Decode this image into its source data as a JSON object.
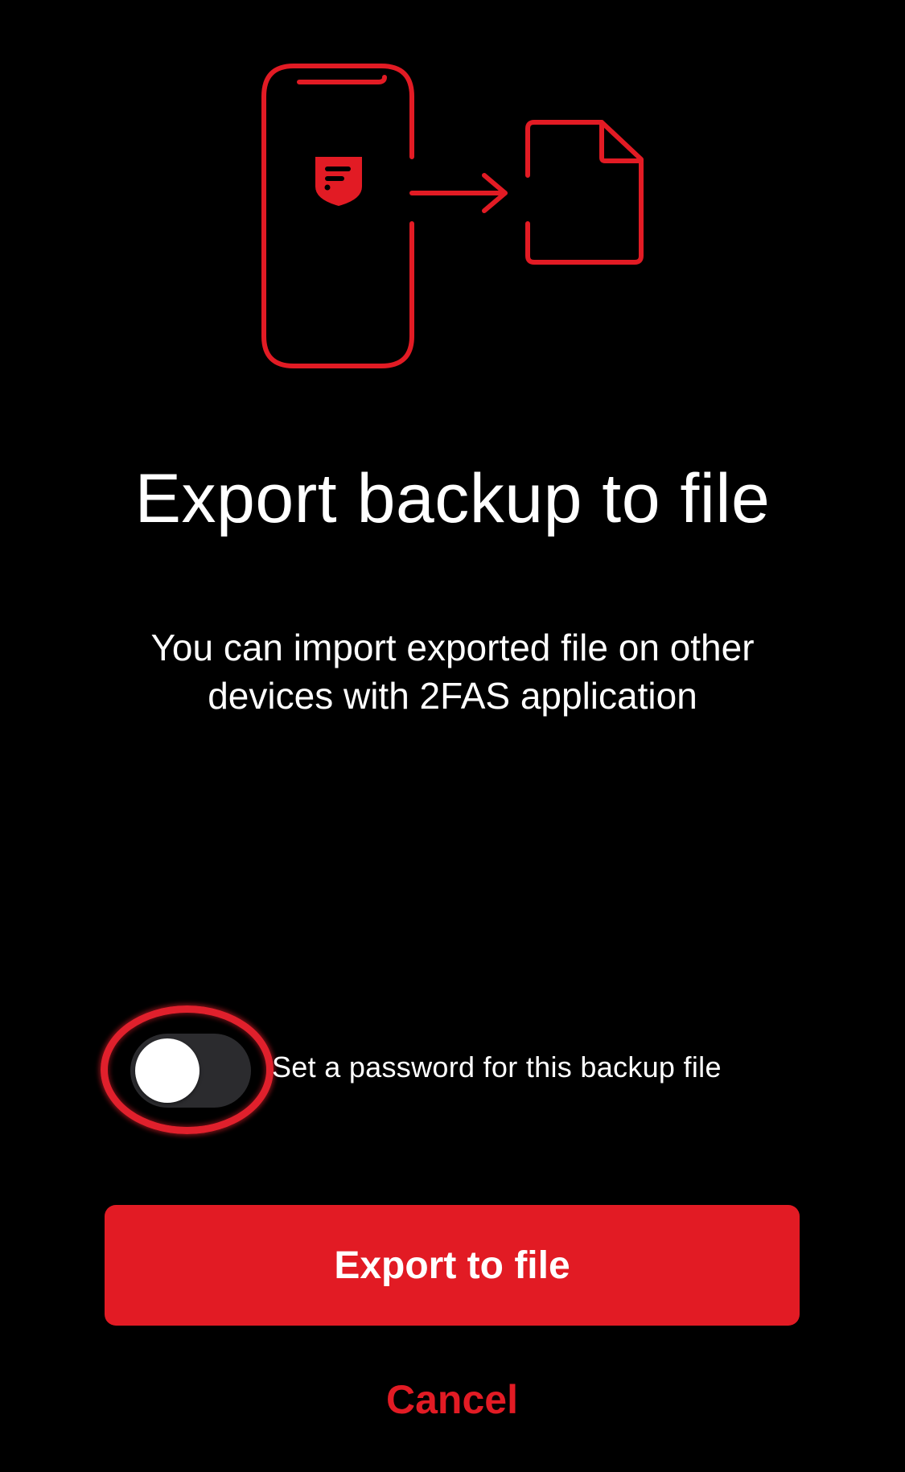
{
  "colors": {
    "background": "#000000",
    "accent": "#e21b24",
    "text": "#ffffff",
    "toggle_track_off": "#2b2b2e"
  },
  "illustration": {
    "phone_icon": "phone-outline-icon",
    "logo_icon": "2fas-shield-logo-icon",
    "arrow_icon": "arrow-right-icon",
    "file_icon": "document-file-icon"
  },
  "main": {
    "title": "Export backup to file",
    "subtitle": "You can import exported file on other devices with 2FAS application"
  },
  "password_toggle": {
    "label": "Set a password for this backup file",
    "enabled": false
  },
  "actions": {
    "export_label": "Export to file",
    "cancel_label": "Cancel"
  }
}
